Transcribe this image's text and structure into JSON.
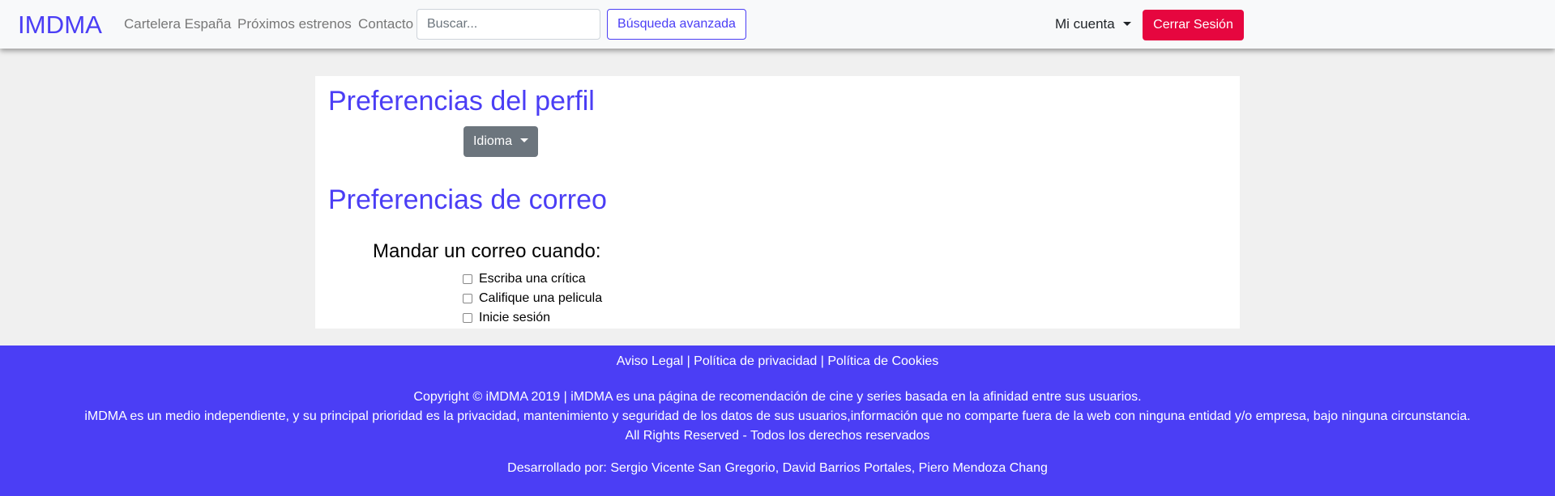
{
  "header": {
    "logo_text": "IMDMA",
    "nav": [
      "Cartelera España",
      "Próximos estrenos",
      "Contacto"
    ],
    "search": {
      "placeholder": "Buscar...",
      "value": ""
    },
    "advanced_search": "Búsqueda avanzada",
    "account": "Mi cuenta",
    "logout": "Cerrar Sesión"
  },
  "main": {
    "profile_title": "Preferencias del perfil",
    "language_button": "Idioma",
    "mail_title": "Preferencias de correo",
    "mail_heading": "Mandar un correo cuando:",
    "options": [
      "Escriba una crítica",
      "Califique una pelicula",
      "Inicie sesión"
    ]
  },
  "footer": {
    "links": "Aviso Legal | Política de privacidad | Política de Cookies",
    "copyright": "Copyright © iMDMA 2019 | iMDMA es una página de recomendación de cine y series basada en la afinidad entre sus usuarios.",
    "description": "iMDMA es un medio independiente, y su principal prioridad es la privacidad, mantenimiento y seguridad de los datos de sus usuarios,información que no comparte fuera de la web con ninguna entidad y/o empresa, bajo ninguna circunstancia.",
    "rights": "All Rights Reserved - Todos los derechos reservados",
    "developers": "Desarrollado por: Sergio Vicente San Gregorio, David Barrios Portales, Piero Mendoza Chang"
  },
  "colors": {
    "brand": "#4b3ef5",
    "logout": "#e6063f",
    "secondary": "#6c757d"
  }
}
